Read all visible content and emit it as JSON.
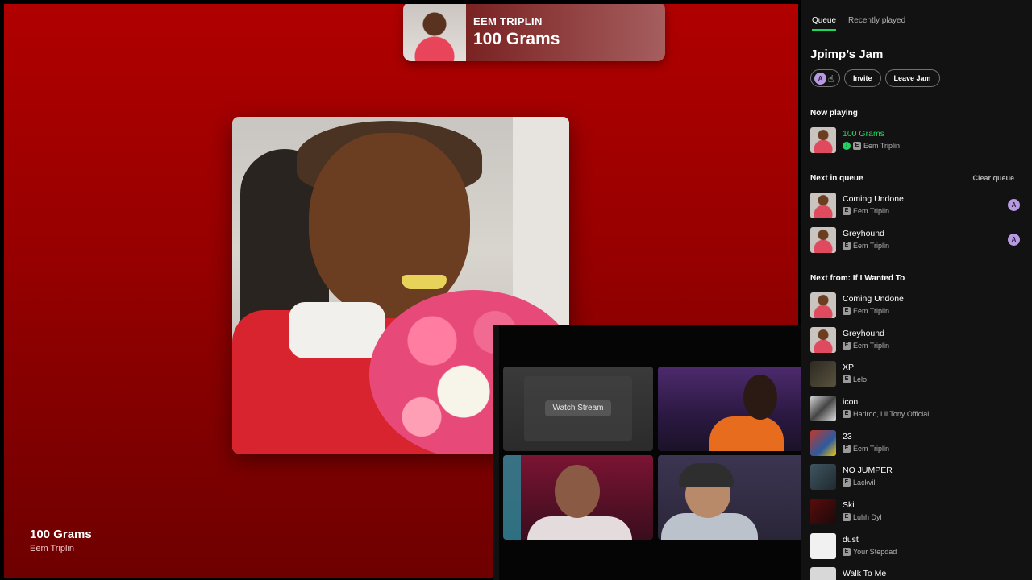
{
  "now_playing_banner": {
    "artist": "EEM TRIPLIN",
    "title": "100 Grams"
  },
  "player": {
    "title": "100 Grams",
    "artist": "Eem Triplin"
  },
  "video_call": {
    "watch_stream_label": "Watch Stream"
  },
  "sidebar": {
    "tabs": [
      {
        "label": "Queue",
        "active": true
      },
      {
        "label": "Recently played",
        "active": false
      }
    ],
    "jam_title": "Jpimp’s Jam",
    "avatar_initial": "A",
    "invite_label": "Invite",
    "leave_label": "Leave Jam",
    "now_playing_heading": "Now playing",
    "now_playing": {
      "title": "100 Grams",
      "artist": "Eem Triplin"
    },
    "next_in_queue_heading": "Next in queue",
    "clear_queue_label": "Clear queue",
    "next_in_queue": [
      {
        "title": "Coming Undone",
        "artist": "Eem Triplin",
        "added_by": "A"
      },
      {
        "title": "Greyhound",
        "artist": "Eem Triplin",
        "added_by": "A"
      }
    ],
    "next_from_heading": "Next from: If I Wanted To",
    "next_from": [
      {
        "title": "Coming Undone",
        "artist": "Eem Triplin",
        "art": "eem"
      },
      {
        "title": "Greyhound",
        "artist": "Eem Triplin",
        "art": "eem"
      },
      {
        "title": "XP",
        "artist": "Lelo",
        "art": "xp"
      },
      {
        "title": "icon",
        "artist": "Hariroc, Lil Tony Official",
        "art": "icon"
      },
      {
        "title": "23",
        "artist": "Eem Triplin",
        "art": "23"
      },
      {
        "title": "NO JUMPER",
        "artist": "Lackvill",
        "art": "nojumper"
      },
      {
        "title": "Ski",
        "artist": "Luhh Dyl",
        "art": "ski"
      },
      {
        "title": "dust",
        "artist": "Your Stepdad",
        "art": "dust"
      },
      {
        "title": "Walk To Me",
        "artist": "",
        "art": "walk"
      }
    ]
  },
  "colors": {
    "accent": "#1ed760",
    "player_bg": "#b00000",
    "sidebar_bg": "#121212"
  }
}
